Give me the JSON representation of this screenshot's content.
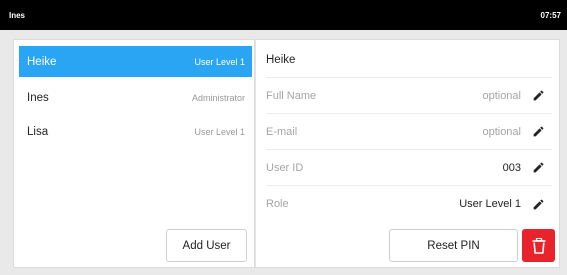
{
  "statusbar": {
    "title": "Ines",
    "time": "07:57"
  },
  "users": [
    {
      "name": "Heike",
      "role": "User Level 1",
      "selected": true
    },
    {
      "name": "Ines",
      "role": "Administrator",
      "selected": false
    },
    {
      "name": "Lisa",
      "role": "User Level 1",
      "selected": false
    }
  ],
  "add_user_label": "Add User",
  "detail": {
    "name": "Heike",
    "fields": [
      {
        "label": "Full Name",
        "value": "optional",
        "placeholder": true
      },
      {
        "label": "E-mail",
        "value": "optional",
        "placeholder": true
      },
      {
        "label": "User ID",
        "value": "003",
        "placeholder": false
      },
      {
        "label": "Role",
        "value": "User Level 1",
        "placeholder": false
      }
    ],
    "reset_pin_label": "Reset PIN"
  },
  "colors": {
    "accent": "#2aa5f3",
    "danger": "#e8232b",
    "statusbar": "#000000"
  },
  "icons": {
    "edit": "pencil-icon",
    "delete": "trash-icon"
  }
}
